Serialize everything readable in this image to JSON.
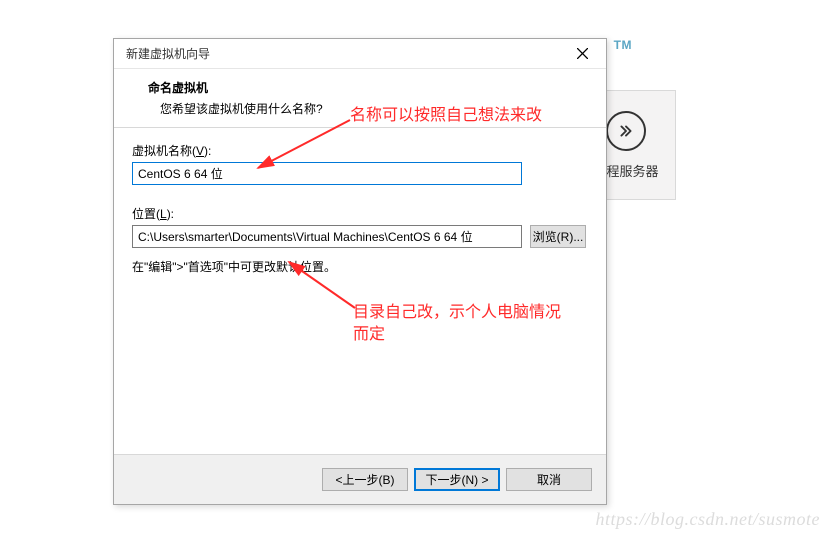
{
  "bg": {
    "tm": "TM",
    "side_label": "远程服务器"
  },
  "dialog": {
    "title": "新建虚拟机向导",
    "header_title": "命名虚拟机",
    "header_sub": "您希望该虚拟机使用什么名称?",
    "name_label_prefix": "虚拟机名称(",
    "name_label_key": "V",
    "name_label_suffix": "):",
    "name_value": "CentOS 6 64 位",
    "loc_label_prefix": "位置(",
    "loc_label_key": "L",
    "loc_label_suffix": "):",
    "loc_value": "C:\\Users\\smarter\\Documents\\Virtual Machines\\CentOS 6 64 位",
    "browse_label": "浏览(R)...",
    "hint": "在\"编辑\">\"首选项\"中可更改默认位置。",
    "back_label": "<上一步(B)",
    "next_label": "下一步(N) >",
    "cancel_label": "取消"
  },
  "annotations": {
    "a1": "名称可以按照自己想法来改",
    "a2_line1": "目录自己改，示个人电脑情况",
    "a2_line2": "而定"
  },
  "watermark": "https://blog.csdn.net/susmote"
}
